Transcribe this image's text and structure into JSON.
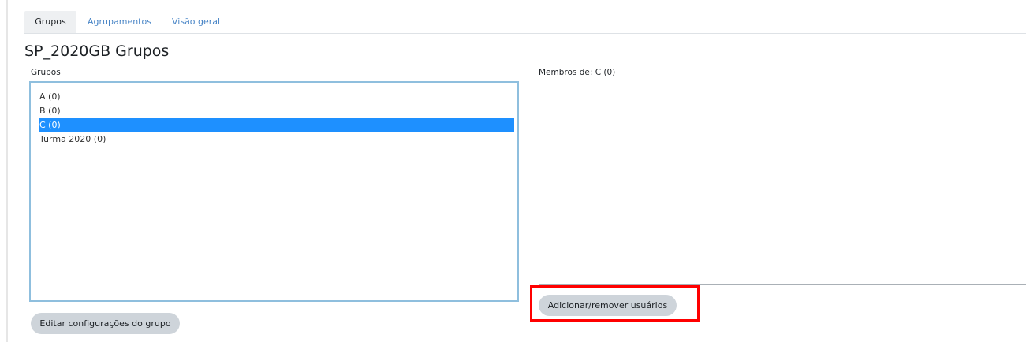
{
  "tabs": [
    {
      "label": "Grupos",
      "active": true
    },
    {
      "label": "Agrupamentos",
      "active": false
    },
    {
      "label": "Visão geral",
      "active": false
    }
  ],
  "page_title": "SP_2020GB Grupos",
  "groups": {
    "label": "Grupos",
    "options": [
      {
        "label": "A (0)",
        "selected": false
      },
      {
        "label": "B (0)",
        "selected": false
      },
      {
        "label": "C (0)",
        "selected": true
      },
      {
        "label": "Turma 2020 (0)",
        "selected": false
      }
    ],
    "edit_button": "Editar configurações do grupo"
  },
  "members": {
    "label": "Membros de: C (0)",
    "add_remove_button": "Adicionar/remover usuários"
  },
  "colors": {
    "accent_link": "#4a86c7",
    "selected_bg": "#1e90ff",
    "list_border": "#8fbfde",
    "button_bg": "#ced4da",
    "highlight": "#ff0000"
  }
}
